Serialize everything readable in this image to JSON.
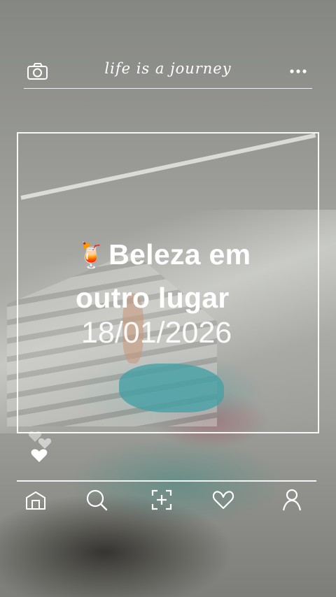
{
  "header": {
    "title": "life is a journey",
    "camera_icon": "camera-icon",
    "more_icon": "more-dots-icon"
  },
  "post": {
    "caption_emoji": "🍹",
    "caption": "Beleza em outro lugar",
    "date": "18/01/2026"
  },
  "reactions": {
    "icon": "floating-hearts-icon"
  },
  "bottom_nav": {
    "items": [
      {
        "name": "home",
        "icon": "home-icon"
      },
      {
        "name": "search",
        "icon": "search-icon"
      },
      {
        "name": "create",
        "icon": "add-post-icon"
      },
      {
        "name": "likes",
        "icon": "heart-icon"
      },
      {
        "name": "profile",
        "icon": "profile-icon"
      }
    ]
  },
  "colors": {
    "foreground": "#ffffff",
    "background": "#8f918c"
  }
}
